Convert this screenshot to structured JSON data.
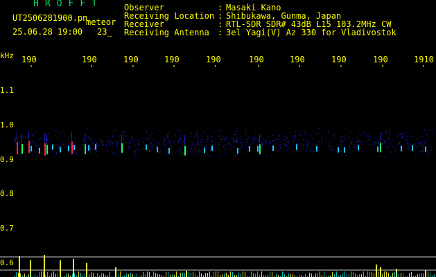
{
  "header": {
    "brand": "HROFFT",
    "filename": "UT2506281900.pn",
    "tag": "meteor",
    "datetime": "25.06.28 19:00",
    "count": "23_"
  },
  "info": {
    "rows": [
      {
        "label": "Observer",
        "value": "Masaki Kano"
      },
      {
        "label": "Receiving Location",
        "value": "Shibukawa, Gunma, Japan"
      },
      {
        "label": "Receiver",
        "value": "RTL-SDR SDR# 43dB L15 103.2MHz CW"
      },
      {
        "label": "Receiving Antenna",
        "value": "3el Yagi(V) Az 330 for Vladivostok"
      }
    ],
    "separator": ":"
  },
  "spectrogram": {
    "unit": "kHz",
    "time_labels": [
      "190",
      "190",
      "190",
      "190",
      "190",
      "190",
      "190",
      "190",
      "190",
      "1910"
    ],
    "freq_labels": [
      "1.1",
      "1.0",
      "0.9",
      "0.8",
      "0.7",
      "0.6"
    ],
    "colors": {
      "background": "#000000",
      "text": "#ffff00",
      "brand": "#00e060",
      "grid": "#ffffff",
      "noise": "#2020c0",
      "echo_strong": "#ff2050",
      "echo_mid": "#20ff60",
      "echo_weak": "#20c0ff",
      "histogram_main": "#ffff30",
      "histogram_sub": "#00e0e0"
    }
  }
}
